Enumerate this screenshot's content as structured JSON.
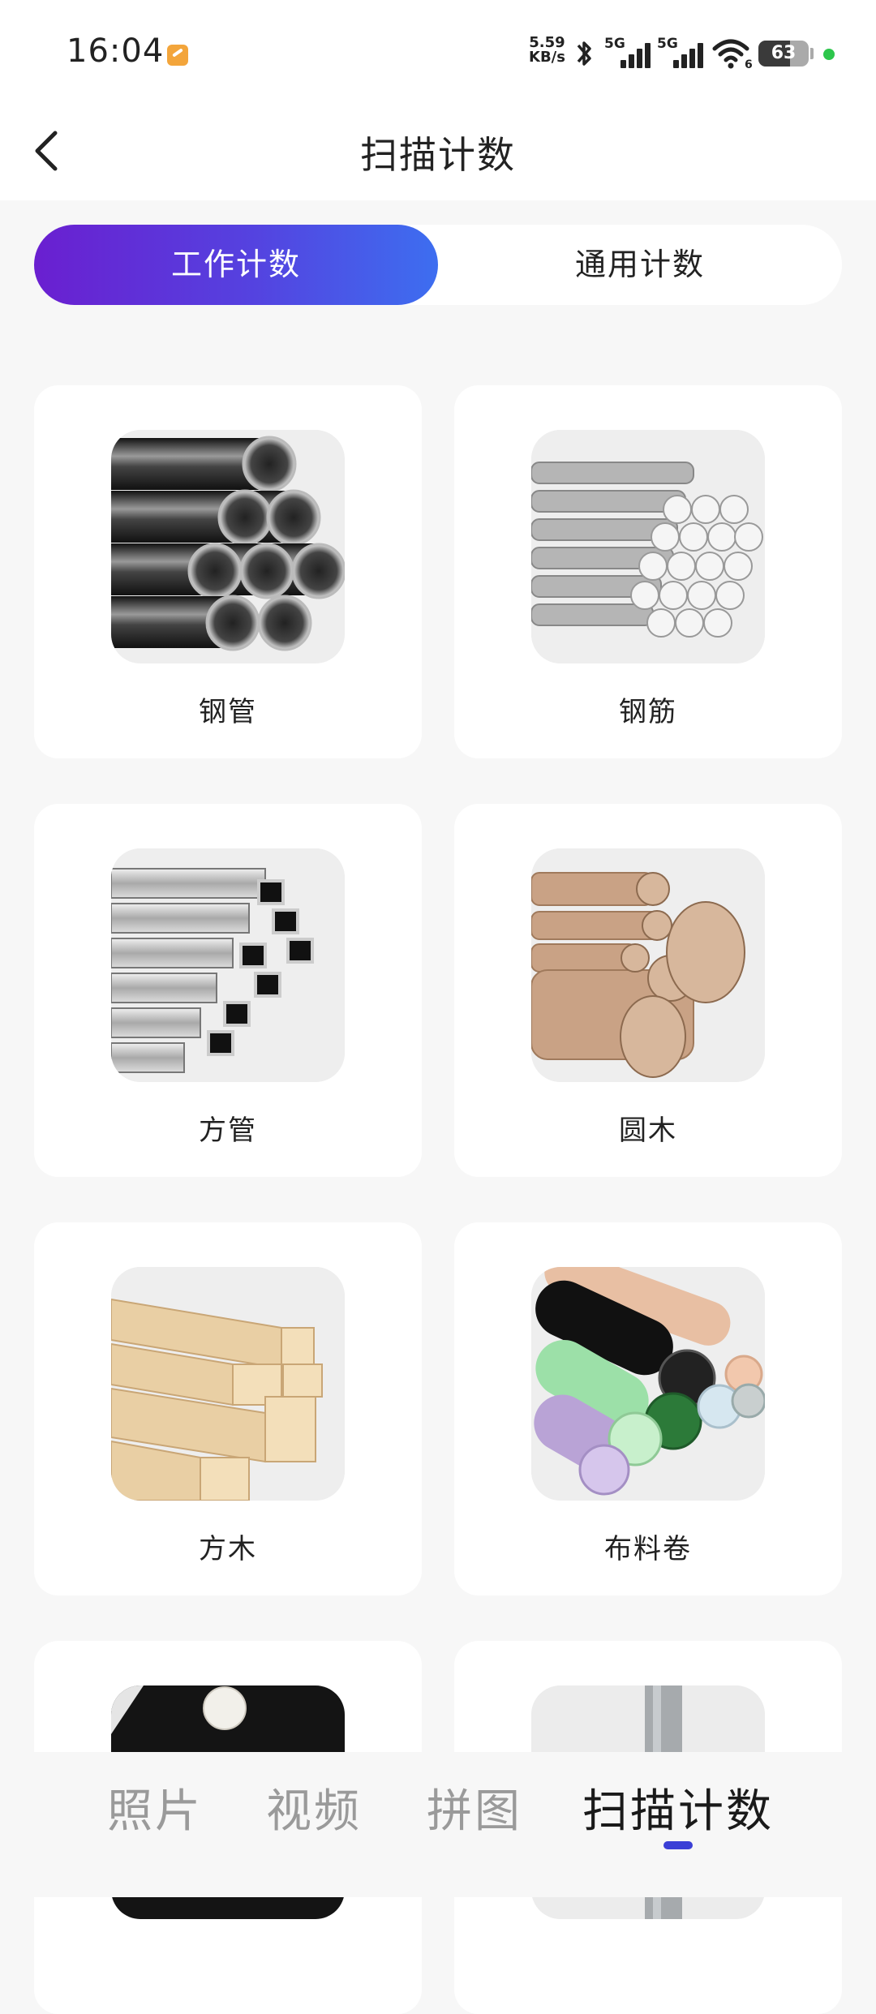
{
  "status_bar": {
    "time": "16:04",
    "net_speed_value": "5.59",
    "net_speed_unit": "KB/s",
    "sim1_label": "5G",
    "sim2_label": "5G",
    "wifi_label": "6",
    "battery": "63",
    "battery_level": 0.63
  },
  "header": {
    "title": "扫描计数"
  },
  "segmented": {
    "options": [
      "工作计数",
      "通用计数"
    ],
    "selected_index": 0
  },
  "grid": {
    "items": [
      {
        "label": "钢管"
      },
      {
        "label": "钢筋"
      },
      {
        "label": "方管"
      },
      {
        "label": "圆木"
      },
      {
        "label": "方木"
      },
      {
        "label": "布料卷"
      },
      {
        "label": ""
      },
      {
        "label": ""
      }
    ]
  },
  "bottom_nav": {
    "items": [
      "照片",
      "视频",
      "拼图",
      "扫描计数"
    ],
    "active_index": 3
  },
  "colors": {
    "accent_start": "#6a1fd0",
    "accent_end": "#3d6ef0",
    "indicator": "#3b3fd6",
    "status_dot": "#2dc64c"
  }
}
